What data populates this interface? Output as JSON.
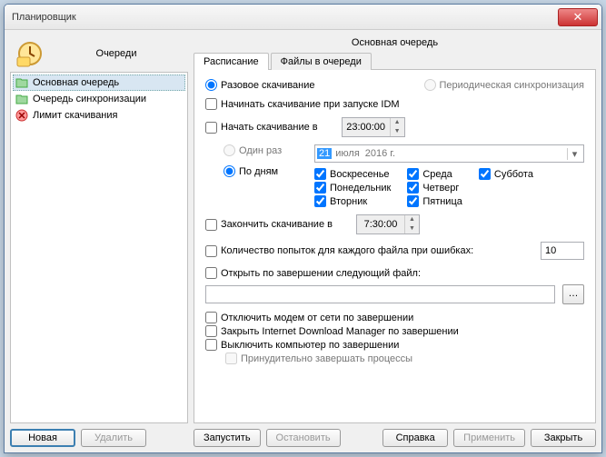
{
  "window": {
    "title": "Планировщик"
  },
  "sidebar": {
    "title": "Очереди",
    "items": [
      {
        "label": "Основная очередь"
      },
      {
        "label": "Очередь синхронизации"
      },
      {
        "label": "Лимит скачивания"
      }
    ],
    "new_btn": "Новая",
    "delete_btn": "Удалить"
  },
  "main": {
    "title": "Основная очередь",
    "tabs": {
      "schedule": "Расписание",
      "files": "Файлы в очереди"
    },
    "mode": {
      "once": "Разовое скачивание",
      "sync": "Периодическая синхронизация"
    },
    "start_on_launch": "Начинать скачивание при запуске IDM",
    "start_at": {
      "label": "Начать скачивание в",
      "time": "23:00:00"
    },
    "freq": {
      "once": "Один раз",
      "byday": "По дням",
      "date_day": "21",
      "date_month": "июля",
      "date_year": "2016 г."
    },
    "days": {
      "sun": "Воскресенье",
      "mon": "Понедельник",
      "tue": "Вторник",
      "wed": "Среда",
      "thu": "Четверг",
      "fri": "Пятница",
      "sat": "Суббота"
    },
    "stop_at": {
      "label": "Закончить скачивание в",
      "time": "7:30:00"
    },
    "retries": {
      "label": "Количество попыток для каждого файла при ошибках:",
      "value": "10"
    },
    "open_after": {
      "label": "Открыть по завершении следующий файл:",
      "value": ""
    },
    "disconnect": "Отключить модем от сети по завершении",
    "close_idm": "Закрыть Internet Download Manager по завершении",
    "shutdown": "Выключить компьютер по завершении",
    "force_kill": "Принудительно завершать процессы"
  },
  "buttons": {
    "run": "Запустить",
    "stop": "Остановить",
    "help": "Справка",
    "apply": "Применить",
    "close": "Закрыть"
  }
}
